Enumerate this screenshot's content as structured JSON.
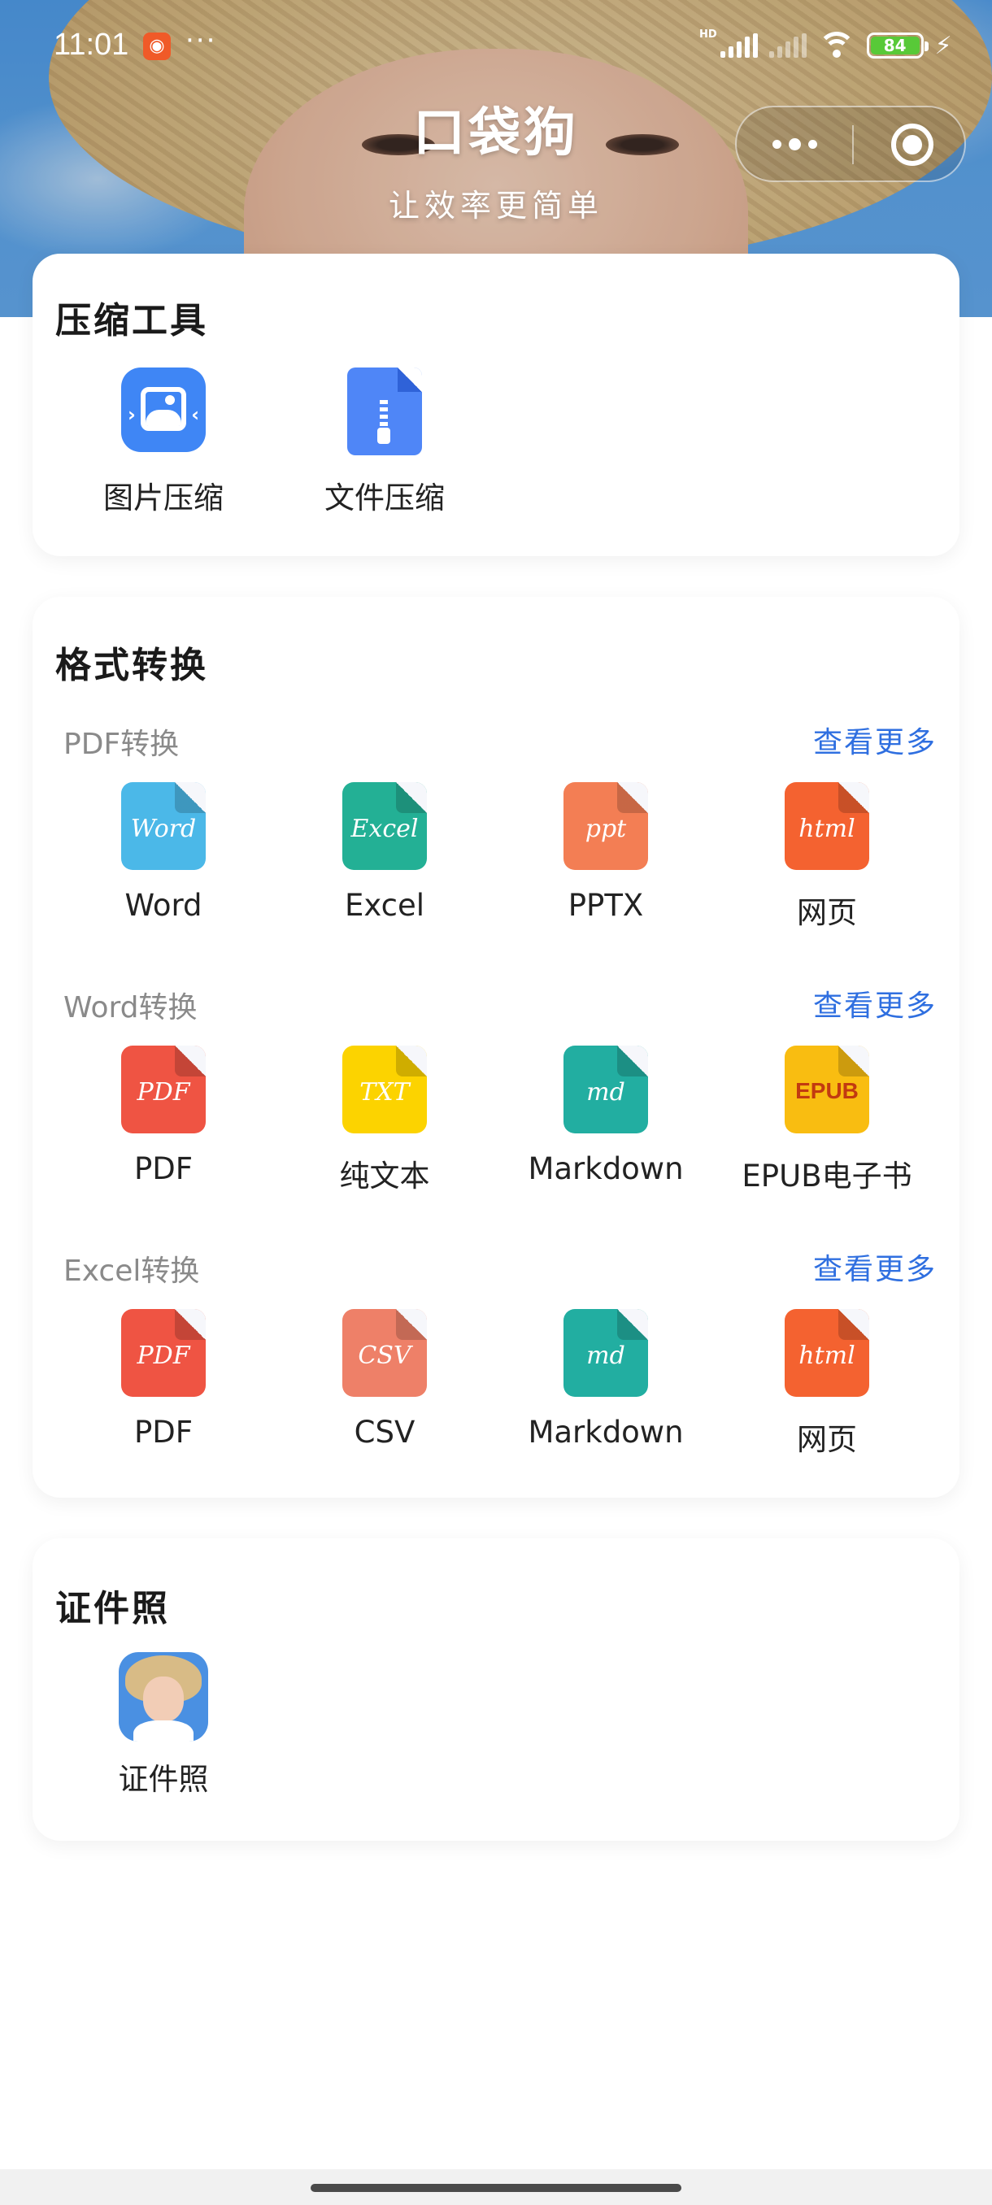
{
  "status_bar": {
    "time": "11:01",
    "app_icon": "app-notification-icon",
    "overflow": "···",
    "hd_label": "HD",
    "battery_level": "84",
    "charging_icon": "lightning-icon"
  },
  "header": {
    "title": "口袋狗",
    "subtitle": "让效率更简单",
    "capsule": {
      "more_icon": "more-dots-icon",
      "close_icon": "circle-target-icon"
    }
  },
  "compression": {
    "title": "压缩工具",
    "tools": [
      {
        "label": "图片压缩",
        "icon": "image-compress-icon",
        "color": "#3f86f5"
      },
      {
        "label": "文件压缩",
        "icon": "zip-file-icon",
        "color": "#4f86f7"
      }
    ]
  },
  "format_conversion": {
    "title": "格式转换",
    "groups": [
      {
        "label": "PDF转换",
        "more": "查看更多",
        "items": [
          {
            "label": "Word",
            "glyph": "Word",
            "color": "#4bb8e8"
          },
          {
            "label": "Excel",
            "glyph": "Excel",
            "color": "#23b095"
          },
          {
            "label": "PPTX",
            "glyph": "ppt",
            "color": "#f37e54"
          },
          {
            "label": "网页",
            "glyph": "html",
            "color": "#f46230"
          }
        ]
      },
      {
        "label": "Word转换",
        "more": "查看更多",
        "items": [
          {
            "label": "PDF",
            "glyph": "PDF",
            "color": "#ef5443"
          },
          {
            "label": "纯文本",
            "glyph": "TXT",
            "color": "#fcd300"
          },
          {
            "label": "Markdown",
            "glyph": "md",
            "color": "#22aea1"
          },
          {
            "label": "EPUB电子书",
            "glyph": "EPUB",
            "color": "#f9bd11"
          }
        ]
      },
      {
        "label": "Excel转换",
        "more": "查看更多",
        "items": [
          {
            "label": "PDF",
            "glyph": "PDF",
            "color": "#ef5443"
          },
          {
            "label": "CSV",
            "glyph": "CSV",
            "color": "#ee8068"
          },
          {
            "label": "Markdown",
            "glyph": "md",
            "color": "#22aea1"
          },
          {
            "label": "网页",
            "glyph": "html",
            "color": "#f46230"
          }
        ]
      }
    ]
  },
  "id_photo": {
    "title": "证件照",
    "tools": [
      {
        "label": "证件照",
        "icon": "id-photo-thumbnail",
        "color": "#4a90e2"
      }
    ]
  },
  "colors": {
    "accent_link": "#2f6fe0",
    "header_sky": "#5fa6ea",
    "card_bg": "#ffffff"
  }
}
